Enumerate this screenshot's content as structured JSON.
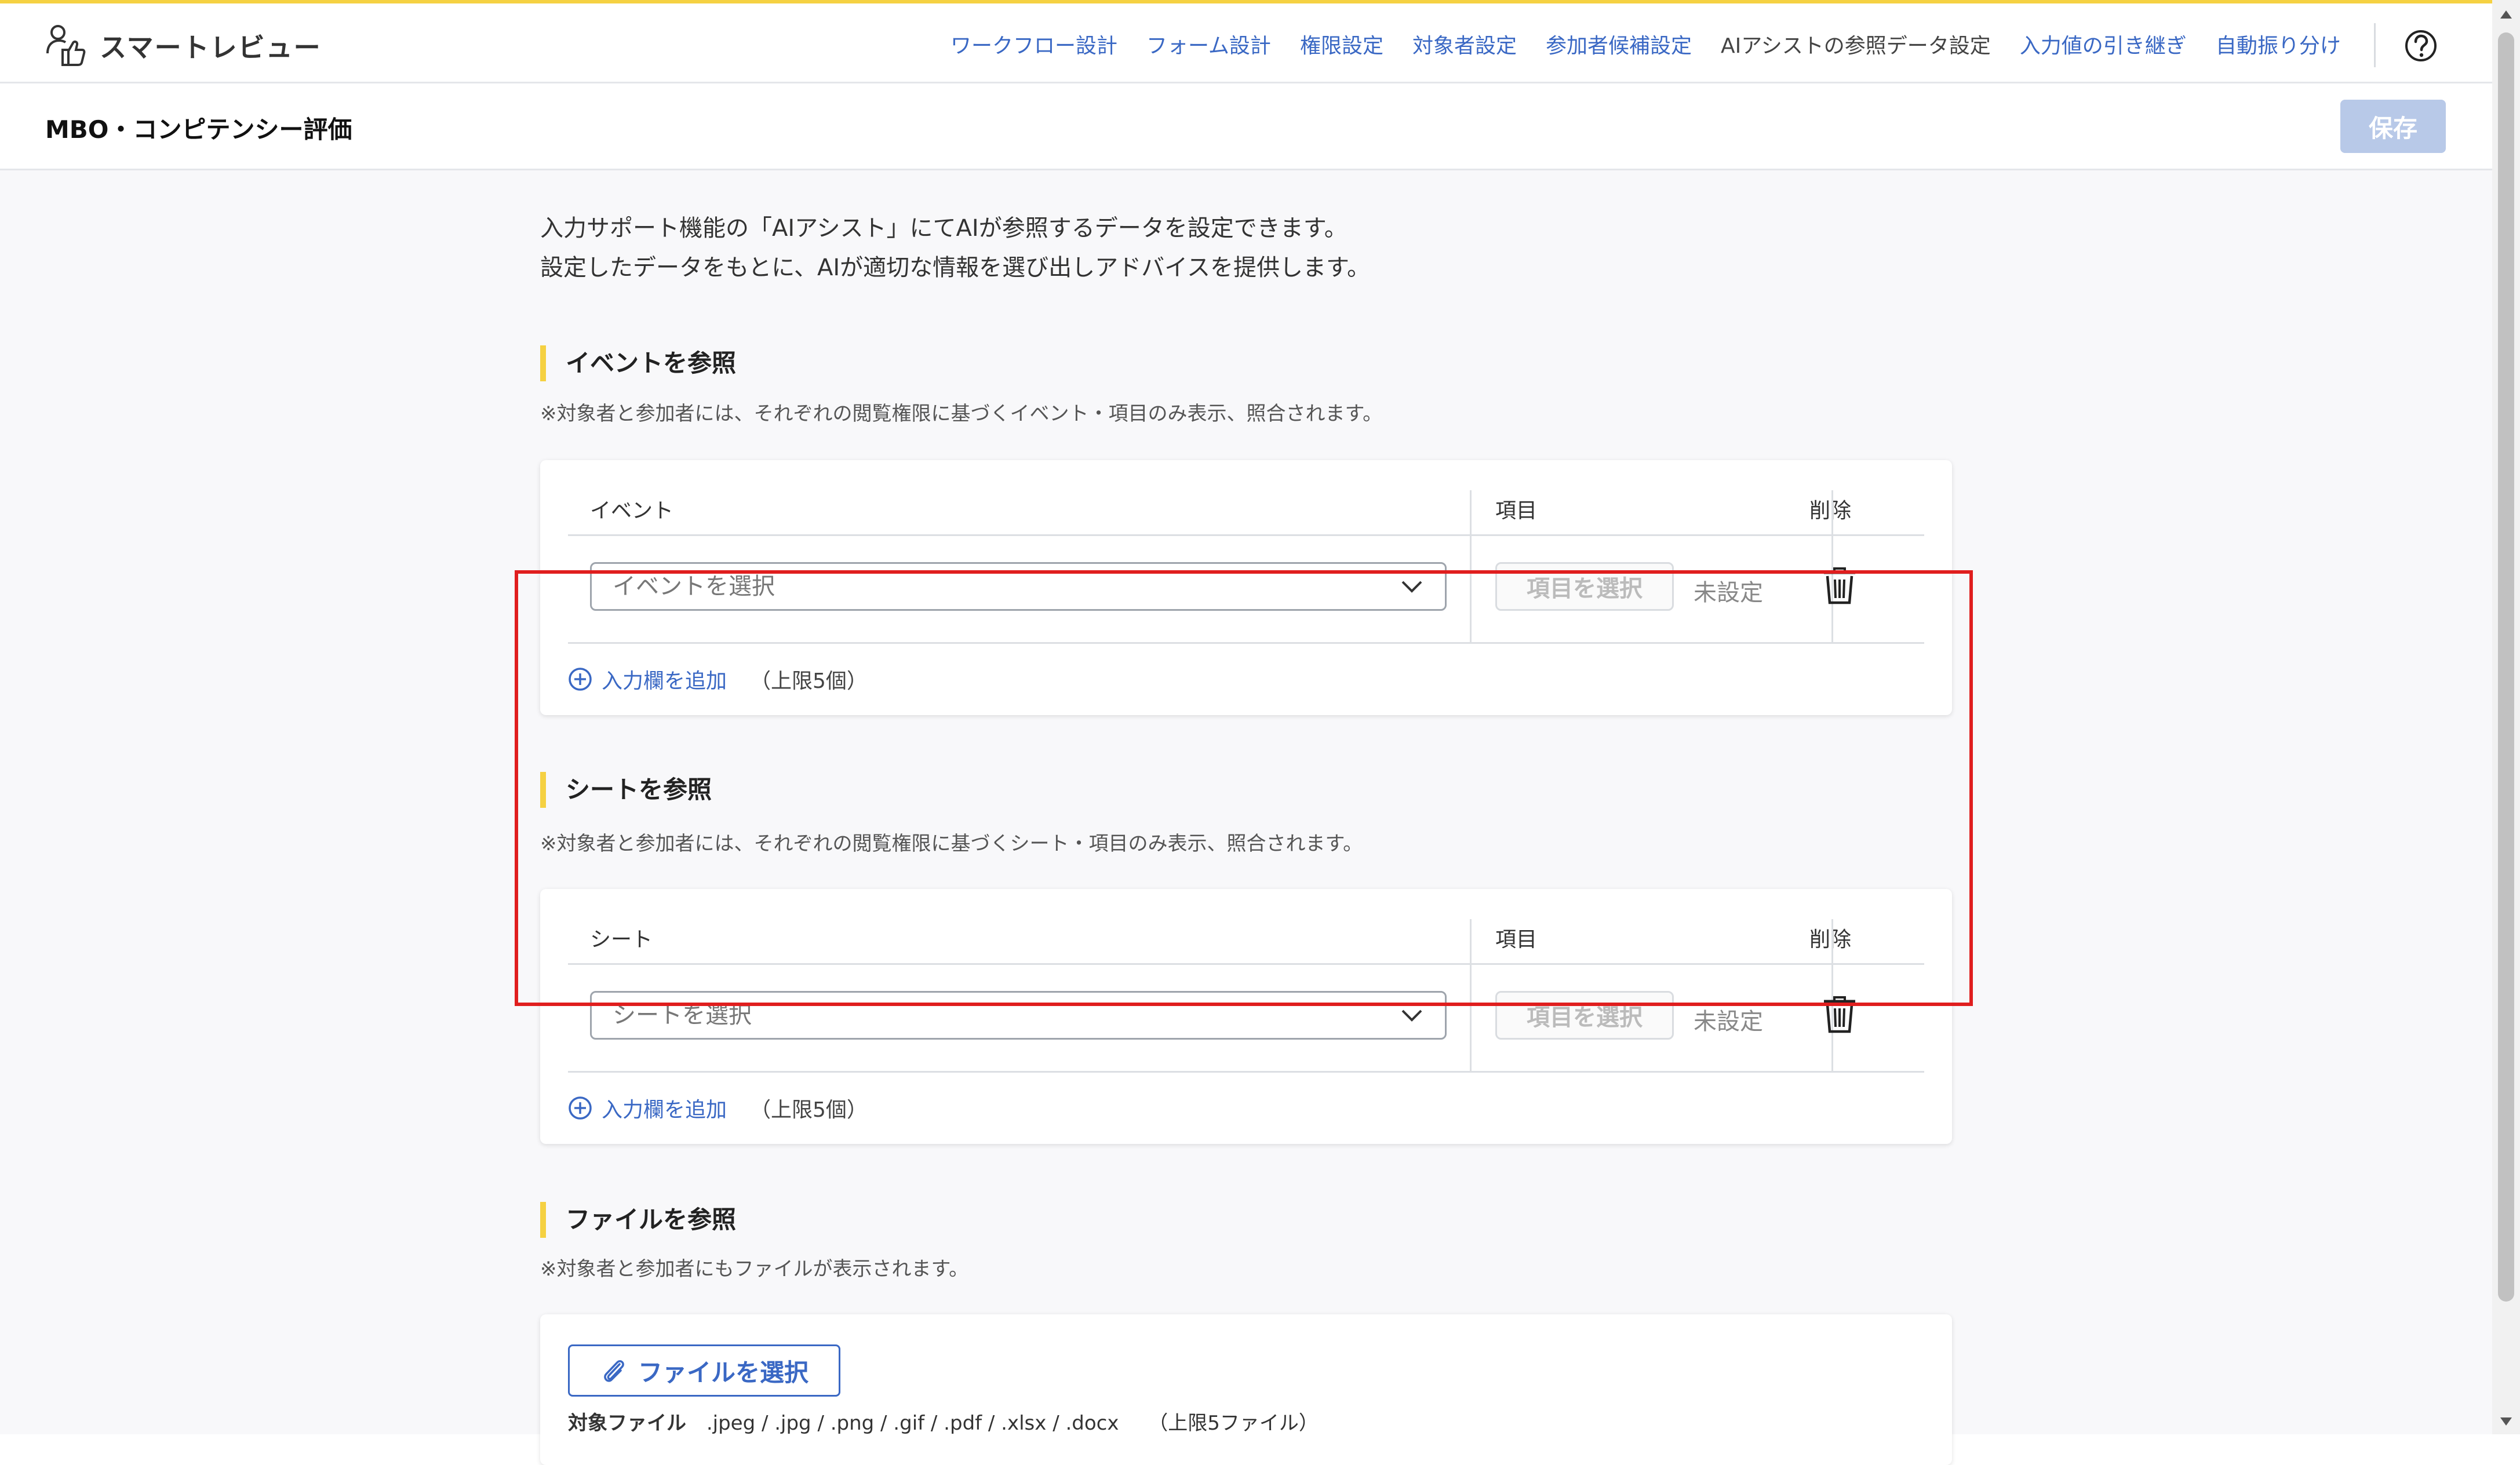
{
  "app": {
    "name": "スマートレビュー"
  },
  "nav": {
    "items": [
      {
        "label": "ワークフロー設計"
      },
      {
        "label": "フォーム設計"
      },
      {
        "label": "権限設定"
      },
      {
        "label": "対象者設定"
      },
      {
        "label": "参加者候補設定"
      },
      {
        "label": "AIアシストの参照データ設定"
      },
      {
        "label": "入力値の引き継ぎ"
      },
      {
        "label": "自動振り分け"
      }
    ],
    "current_index": 5
  },
  "header": {
    "title": "MBO・コンピテンシー評価",
    "save_label": "保存"
  },
  "intro": {
    "line1": "入力サポート機能の「AIアシスト」にてAIが参照するデータを設定できます。",
    "line2": "設定したデータをもとに、AIが適切な情報を選び出しアドバイスを提供します。"
  },
  "event_section": {
    "title": "イベントを参照",
    "note": "※対象者と参加者には、それぞれの閲覧権限に基づくイベント・項目のみ表示、照合されます。",
    "col_main": "イベント",
    "col_item": "項目",
    "col_delete": "削除",
    "select_placeholder": "イベントを選択",
    "item_button": "項目を選択",
    "item_status": "未設定",
    "add_label": "入力欄を追加",
    "limit": "（上限5個）"
  },
  "sheet_section": {
    "title": "シートを参照",
    "note": "※対象者と参加者には、それぞれの閲覧権限に基づくシート・項目のみ表示、照合されます。",
    "col_main": "シート",
    "col_item": "項目",
    "col_delete": "削除",
    "select_placeholder": "シートを選択",
    "item_button": "項目を選択",
    "item_status": "未設定",
    "add_label": "入力欄を追加",
    "limit": "（上限5個）"
  },
  "file_section": {
    "title": "ファイルを参照",
    "note": "※対象者と参加者にもファイルが表示されます。",
    "button": "ファイルを選択",
    "types_label": "対象ファイル",
    "types": ".jpeg / .jpg / .png / .gif / .pdf / .xlsx / .docx",
    "limit": "（上限5ファイル）"
  },
  "colors": {
    "accent": "#3a68c4",
    "brand_yellow": "#f5d142",
    "highlight_red": "#e01e1e",
    "save_disabled": "#b8c9e8"
  },
  "icons": {
    "brand": "user-thumbs-up-icon",
    "help": "help-circle-icon",
    "dropdown": "chevron-down-icon",
    "delete": "trash-icon",
    "add": "plus-circle-icon",
    "attach": "paperclip-icon"
  }
}
